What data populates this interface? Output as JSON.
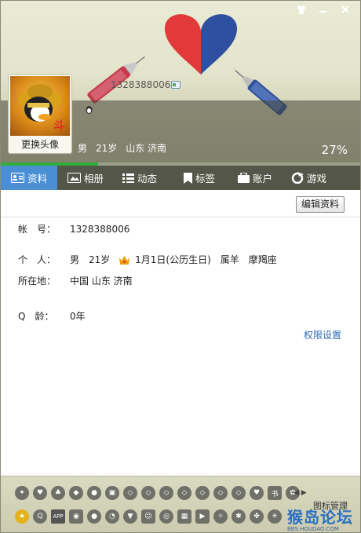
{
  "window_controls": {
    "skin": "skin-icon",
    "minimize": "minimize-icon",
    "close": "close-icon"
  },
  "profile": {
    "change_avatar_label": "更换头像",
    "qq_number": "1328388006",
    "summary": {
      "gender": "男",
      "age": "21岁",
      "location": "山东 济南"
    },
    "completion_percent": "27%",
    "completion_fraction": 0.27
  },
  "tabs": [
    {
      "label": "资料",
      "icon": "profile-card-icon",
      "active": true
    },
    {
      "label": "相册",
      "icon": "album-icon",
      "active": false
    },
    {
      "label": "动态",
      "icon": "feed-icon",
      "active": false
    },
    {
      "label": "标签",
      "icon": "tag-icon",
      "active": false
    },
    {
      "label": "账户",
      "icon": "wallet-icon",
      "active": false
    },
    {
      "label": "游戏",
      "icon": "game-icon",
      "active": false
    }
  ],
  "details": {
    "edit_button": "编辑资料",
    "account": {
      "label": "帐　号：",
      "value": "1328388006"
    },
    "personal": {
      "label": "个　人：",
      "gender": "男",
      "age": "21岁",
      "birthday": "1月1日(公历生日)",
      "zodiac": "属羊",
      "constellation": "摩羯座"
    },
    "location": {
      "label": "所在地：",
      "value": "中国 山东 济南"
    },
    "qq_age": {
      "label": "Q　龄：",
      "value": "0年"
    },
    "permission_link": "权限设置"
  },
  "footer": {
    "manage_label": "图标管理",
    "watermark": "猴岛论坛",
    "watermark_url": "BBS.HOUDAO.COM",
    "arrows": "◀ ▶"
  }
}
